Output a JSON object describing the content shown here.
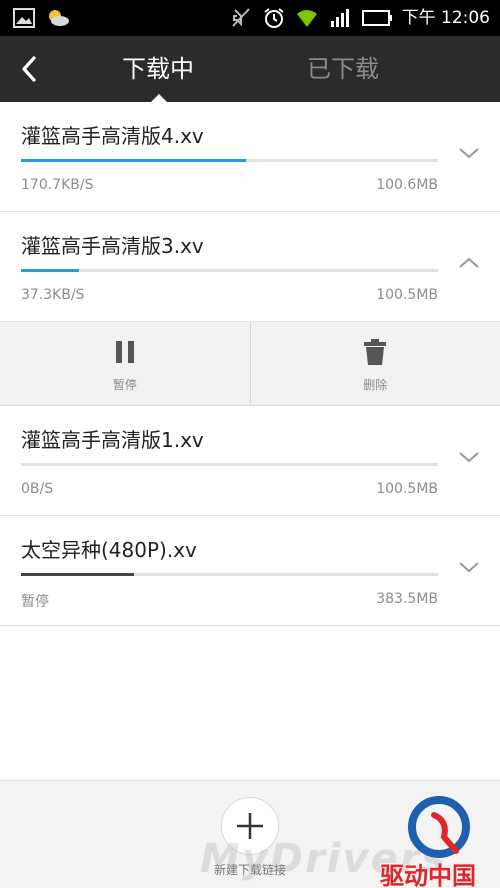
{
  "status_bar": {
    "time": "下午 12:06",
    "icons": [
      "image-icon",
      "weather-icon",
      "mute-icon",
      "alarm-icon",
      "wifi-icon",
      "signal-icon",
      "battery-icon"
    ]
  },
  "header": {
    "tabs": [
      {
        "label": "下载中",
        "active": true
      },
      {
        "label": "已下载",
        "active": false
      }
    ]
  },
  "downloads": [
    {
      "name": "灌篮高手高清版4.xv",
      "speed": "170.7KB/S",
      "size": "100.6MB",
      "progress": 0.54,
      "expanded": false
    },
    {
      "name": "灌篮高手高清版3.xv",
      "speed": "37.3KB/S",
      "size": "100.5MB",
      "progress": 0.14,
      "expanded": true
    },
    {
      "name": "灌篮高手高清版1.xv",
      "speed": "0B/S",
      "size": "100.5MB",
      "progress": 0.0,
      "expanded": false
    },
    {
      "name": "太空异种(480P).xv",
      "speed": "暂停",
      "size": "383.5MB",
      "progress": 0.27,
      "expanded": false,
      "paused": true
    }
  ],
  "actions": {
    "pause_label": "暂停",
    "delete_label": "删除"
  },
  "bottom": {
    "add_label": "新建下载链接"
  },
  "watermark": {
    "text": "MyDrivers",
    "logo_text": "驱动中国"
  },
  "colors": {
    "accent": "#2a9bd6",
    "header_bg": "#2b2b2b",
    "logo_red": "#e0262a",
    "logo_blue": "#1f5fae"
  }
}
